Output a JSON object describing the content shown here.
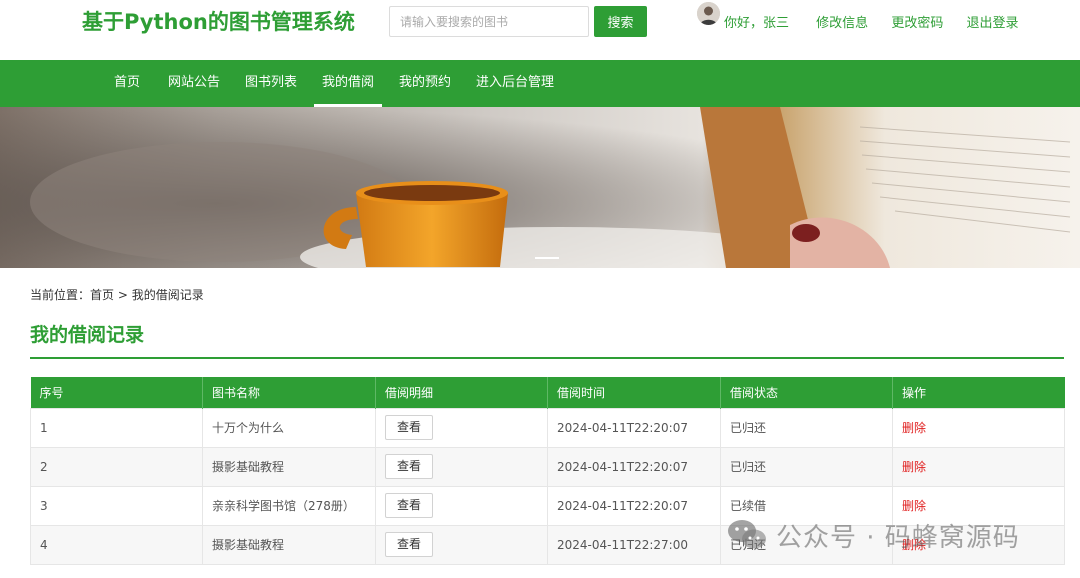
{
  "header": {
    "site_title": "基于Python的图书管理系统",
    "search_placeholder": "请输入要搜索的图书",
    "search_button": "搜索",
    "greeting": "你好，张三",
    "edit_profile": "修改信息",
    "change_password": "更改密码",
    "logout": "退出登录"
  },
  "nav": {
    "items": [
      {
        "label": "首页"
      },
      {
        "label": "网站公告"
      },
      {
        "label": "图书列表"
      },
      {
        "label": "我的借阅"
      },
      {
        "label": "我的预约"
      },
      {
        "label": "进入后台管理"
      }
    ],
    "active_label": "我的借阅"
  },
  "breadcrumb": {
    "prefix": "当前位置：",
    "home": "首页",
    "separator": " > ",
    "current": "我的借阅记录"
  },
  "section": {
    "title": "我的借阅记录"
  },
  "table": {
    "headers": [
      "序号",
      "图书名称",
      "借阅明细",
      "借阅时间",
      "借阅状态",
      "操作"
    ],
    "rows": [
      {
        "index": "1",
        "book": "十万个为什么",
        "detail": "查看",
        "time": "2024-04-11T22:20:07",
        "status": "已归还",
        "action": "删除"
      },
      {
        "index": "2",
        "book": "摄影基础教程",
        "detail": "查看",
        "time": "2024-04-11T22:20:07",
        "status": "已归还",
        "action": "删除"
      },
      {
        "index": "3",
        "book": "亲亲科学图书馆（278册）",
        "detail": "查看",
        "time": "2024-04-11T22:20:07",
        "status": "已续借",
        "action": "删除"
      },
      {
        "index": "4",
        "book": "摄影基础教程",
        "detail": "查看",
        "time": "2024-04-11T22:27:00",
        "status": "已归还",
        "action": "删除"
      }
    ]
  },
  "watermark": {
    "text": "公众号 · 码蜂窝源码"
  },
  "colors": {
    "brand_green": "#2e9e35",
    "delete_red": "#e02020"
  }
}
